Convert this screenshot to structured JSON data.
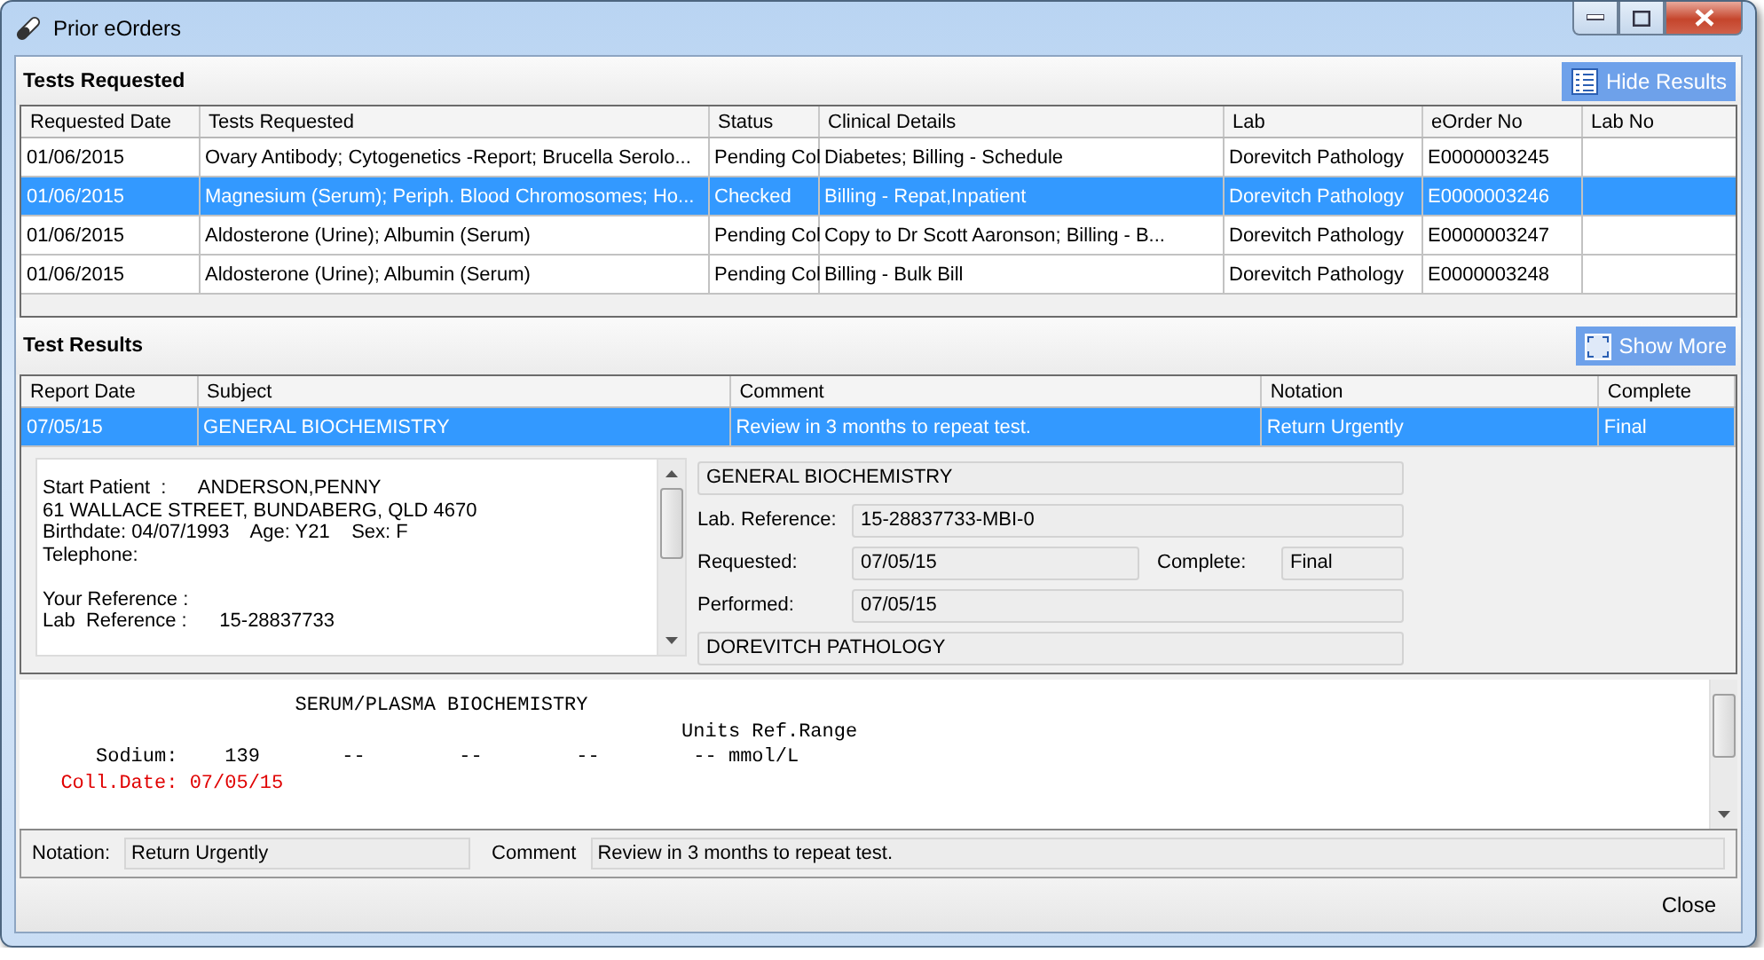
{
  "window": {
    "title": "Prior eOrders"
  },
  "tests_requested": {
    "title": "Tests Requested",
    "button": {
      "label": "Hide Results"
    },
    "columns": [
      "Requested Date",
      "Tests Requested",
      "Status",
      "Clinical Details",
      "Lab",
      "eOrder No",
      "Lab No"
    ],
    "rows": [
      {
        "selected": false,
        "cells": [
          "01/06/2015",
          "Ovary Antibody; Cytogenetics -Report; Brucella Serolo...",
          "Pending Col",
          "Diabetes; Billing - Schedule",
          "Dorevitch Pathology",
          "E0000003245"
        ]
      },
      {
        "selected": true,
        "cells": [
          "01/06/2015",
          "Magnesium (Serum); Periph. Blood Chromosomes; Ho...",
          "Checked",
          "Billing - Repat,Inpatient",
          "Dorevitch Pathology",
          "E0000003246"
        ]
      },
      {
        "selected": false,
        "cells": [
          "01/06/2015",
          "Aldosterone (Urine); Albumin (Serum)",
          "Pending Col",
          "Copy to Dr Scott Aaronson; Billing - B...",
          "Dorevitch Pathology",
          "E0000003247"
        ]
      },
      {
        "selected": false,
        "cells": [
          "01/06/2015",
          "Aldosterone (Urine); Albumin (Serum)",
          "Pending Col",
          "Billing - Bulk Bill",
          "Dorevitch Pathology",
          "E0000003248"
        ]
      }
    ]
  },
  "test_results": {
    "title": "Test Results",
    "button": {
      "label": "Show More"
    },
    "columns": [
      "Report Date",
      "Subject",
      "Comment",
      "Notation",
      "Complete"
    ],
    "rows": [
      {
        "selected": true,
        "cells": [
          "07/05/15",
          "GENERAL BIOCHEMISTRY",
          "Review in 3 months to repeat test.",
          "Return Urgently",
          "Final"
        ]
      }
    ]
  },
  "patient_details": {
    "paragraphs": [
      [
        "Start Patient  :      ANDERSON,PENNY",
        "61 WALLACE STREET, BUNDABERG, QLD 4670",
        "Birthdate: 04/07/1993    Age: Y21    Sex: F",
        "Telephone:"
      ],
      [
        "Your Reference :",
        "Lab  Reference :      15-28837733"
      ]
    ]
  },
  "report_summary": {
    "subject": "GENERAL BIOCHEMISTRY",
    "lab_reference_label": "Lab. Reference:",
    "lab_reference": "15-28837733-MBI-0",
    "requested_label": "Requested:",
    "requested": "07/05/15",
    "complete_label": "Complete:",
    "complete": "Final",
    "performed_label": "Performed:",
    "performed": "07/05/15",
    "lab": "DOREVITCH PATHOLOGY"
  },
  "report_text": {
    "lines": [
      {
        "kind": "plain",
        "text": "                      SERUM/PLASMA BIOCHEMISTRY"
      },
      {
        "kind": "plain",
        "text": "                                                       Units Ref.Range"
      },
      {
        "kind": "plain",
        "text": "     Sodium:    139       --        --        --        -- mmol/L"
      },
      {
        "kind": "highlight",
        "text": "  Coll.Date: 07/05/15"
      }
    ]
  },
  "notation_bar": {
    "notation_label": "Notation:",
    "notation": "Return Urgently",
    "comment_label": "Comment",
    "comment": "Review in 3 months to repeat test."
  },
  "footer": {
    "close_label": "Close"
  }
}
